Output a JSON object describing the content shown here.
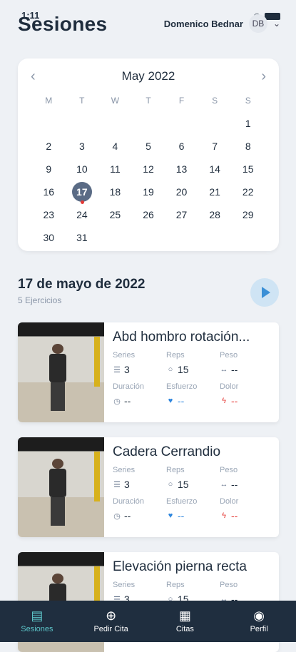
{
  "status": {
    "time": "1:11"
  },
  "header": {
    "title": "Sesiones",
    "user_name": "Domenico Bednar",
    "avatar_initials": "DB"
  },
  "calendar": {
    "month_label": "May 2022",
    "weekdays": [
      "M",
      "T",
      "W",
      "T",
      "F",
      "S",
      "S"
    ],
    "days": [
      "1",
      "2",
      "3",
      "4",
      "5",
      "6",
      "7",
      "8",
      "9",
      "10",
      "11",
      "12",
      "13",
      "14",
      "15",
      "16",
      "17",
      "18",
      "19",
      "20",
      "21",
      "22",
      "23",
      "24",
      "25",
      "26",
      "27",
      "28",
      "29",
      "30",
      "31"
    ],
    "first_weekday_offset": 6,
    "selected_day": "17"
  },
  "session": {
    "date_label": "17 de mayo de 2022",
    "count_label": "5 Ejercicios"
  },
  "labels": {
    "series": "Series",
    "reps": "Reps",
    "peso": "Peso",
    "duracion": "Duración",
    "esfuerzo": "Esfuerzo",
    "dolor": "Dolor"
  },
  "exercises": [
    {
      "title": "Abd hombro rotación...",
      "series": "3",
      "reps": "15",
      "peso": "--",
      "duracion": "--",
      "esfuerzo": "--",
      "dolor": "--"
    },
    {
      "title": "Cadera Cerrandio",
      "series": "3",
      "reps": "15",
      "peso": "--",
      "duracion": "--",
      "esfuerzo": "--",
      "dolor": "--"
    },
    {
      "title": "Elevación pierna recta",
      "series": "3",
      "reps": "15",
      "peso": "--",
      "duracion": "--",
      "esfuerzo": "--",
      "dolor": "--"
    }
  ],
  "tabs": [
    {
      "label": "Sesiones",
      "icon": "clipboard-icon"
    },
    {
      "label": "Pedir Cita",
      "icon": "plus-circle-icon"
    },
    {
      "label": "Citas",
      "icon": "calendar-icon"
    },
    {
      "label": "Perfil",
      "icon": "user-circle-icon"
    }
  ],
  "colors": {
    "accent": "#5cc3c7",
    "selected_day": "#5a6b85",
    "tabbar": "#1f2e3f",
    "play": "#3a8fd6"
  }
}
